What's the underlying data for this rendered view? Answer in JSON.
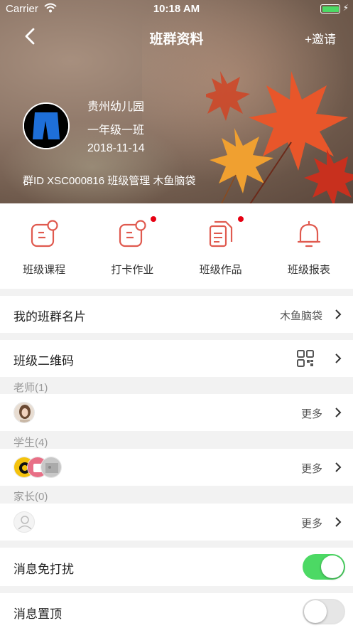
{
  "status_bar": {
    "carrier": "Carrier",
    "time": "10:18 AM"
  },
  "nav": {
    "title": "班群资料",
    "invite": "+邀请"
  },
  "profile": {
    "school": "贵州幼儿园",
    "class_name": "一年级一班",
    "date": "2018-11-14",
    "group_line": "群ID XSC000816 班级管理 木鱼脑袋"
  },
  "actions": [
    {
      "label": "班级课程",
      "icon": "course-icon",
      "badge": false
    },
    {
      "label": "打卡作业",
      "icon": "homework-icon",
      "badge": true
    },
    {
      "label": "班级作品",
      "icon": "works-icon",
      "badge": true
    },
    {
      "label": "班级报表",
      "icon": "bell-icon",
      "badge": false
    }
  ],
  "my_card": {
    "label": "我的班群名片",
    "value": "木鱼脑袋"
  },
  "qrcode": {
    "label": "班级二维码"
  },
  "teachers": {
    "label": "老师(1)",
    "more": "更多"
  },
  "students": {
    "label": "学生(4)",
    "more": "更多"
  },
  "parents": {
    "label": "家长(0)",
    "more": "更多"
  },
  "mute": {
    "label": "消息免打扰",
    "on": true
  },
  "pin": {
    "label": "消息置顶",
    "on": false
  },
  "colors": {
    "accent": "#e05a4f",
    "toggle_on": "#4cd964",
    "badge": "#e60012"
  }
}
